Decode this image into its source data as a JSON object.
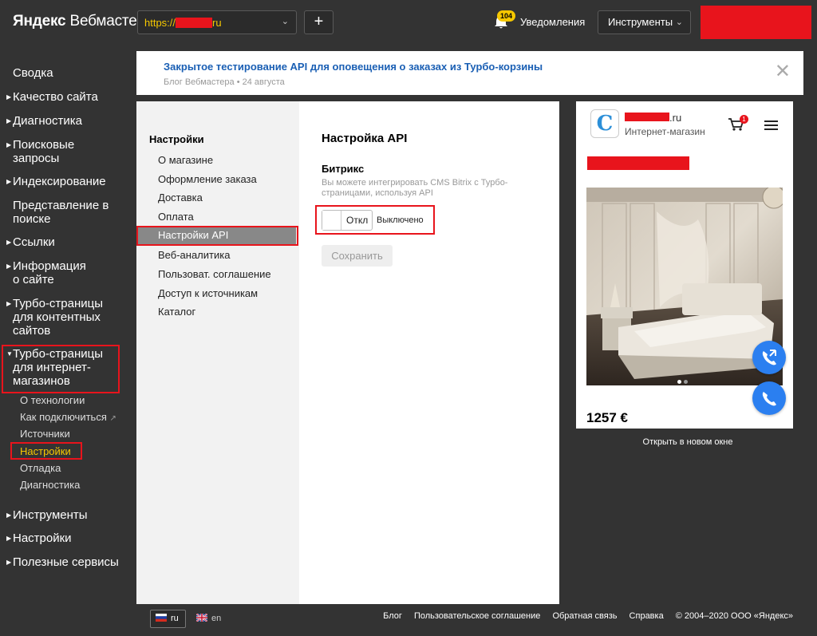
{
  "header": {
    "logo_brand": "Яндекс",
    "logo_product": "Вебмастер",
    "site_url_prefix": "https://",
    "site_url_suffix": "ru",
    "add_label": "+",
    "notifications_count": "104",
    "notifications_label": "Уведомления",
    "tools_label": "Инструменты"
  },
  "sidebar": {
    "items": [
      {
        "label": "Сводка"
      },
      {
        "label": "Качество сайта"
      },
      {
        "label": "Диагностика"
      },
      {
        "label": "Поисковые запросы"
      },
      {
        "label": "Индексирование"
      },
      {
        "label": "Представление в поиске"
      },
      {
        "label": "Ссылки"
      },
      {
        "label": "Информация о сайте"
      },
      {
        "label": "Турбо-страницы для контентных сайтов"
      },
      {
        "label": "Турбо-страницы для интернет-магазинов"
      }
    ],
    "subitems": [
      {
        "label": "О технологии"
      },
      {
        "label": "Как подключиться"
      },
      {
        "label": "Источники"
      },
      {
        "label": "Настройки"
      },
      {
        "label": "Отладка"
      },
      {
        "label": "Диагностика"
      }
    ],
    "bottom_items": [
      {
        "label": "Инструменты"
      },
      {
        "label": "Настройки"
      },
      {
        "label": "Полезные сервисы"
      }
    ]
  },
  "banner": {
    "title": "Закрытое тестирование API для оповещения о заказах из Турбо-корзины",
    "meta": "Блог Вебмастера • 24 августа"
  },
  "settings_menu": {
    "title": "Настройки",
    "items": [
      {
        "label": "О магазине"
      },
      {
        "label": "Оформление заказа"
      },
      {
        "label": "Доставка"
      },
      {
        "label": "Оплата"
      },
      {
        "label": "Настройки API"
      },
      {
        "label": "Веб-аналитика"
      },
      {
        "label": "Пользоват. соглашение"
      },
      {
        "label": "Доступ к источникам"
      },
      {
        "label": "Каталог"
      }
    ]
  },
  "api_settings": {
    "title": "Настройка API",
    "section_title": "Битрикс",
    "description": "Вы можете интегрировать CMS Bitrix с Турбо-страницами, используя API",
    "toggle_label": "Откл",
    "toggle_state": "Выключено",
    "save_label": "Сохранить"
  },
  "preview": {
    "logo_letter": "C",
    "domain_suffix": ".ru",
    "subtitle": "Интернет-магазин",
    "cart_count": "1",
    "price": "1257 €",
    "open_new_label": "Открыть в новом окне"
  },
  "footer": {
    "lang_ru": "ru",
    "lang_en": "en",
    "links": [
      {
        "label": "Блог"
      },
      {
        "label": "Пользовательское соглашение"
      },
      {
        "label": "Обратная связь"
      },
      {
        "label": "Справка"
      }
    ],
    "copyright": "© 2004–2020 ООО «Яндекс»"
  },
  "colors": {
    "background": "#333333",
    "accent": "#f6c800",
    "redaction": "#e8141c",
    "link": "#1a5fb4",
    "fab": "#2b7ff0"
  }
}
